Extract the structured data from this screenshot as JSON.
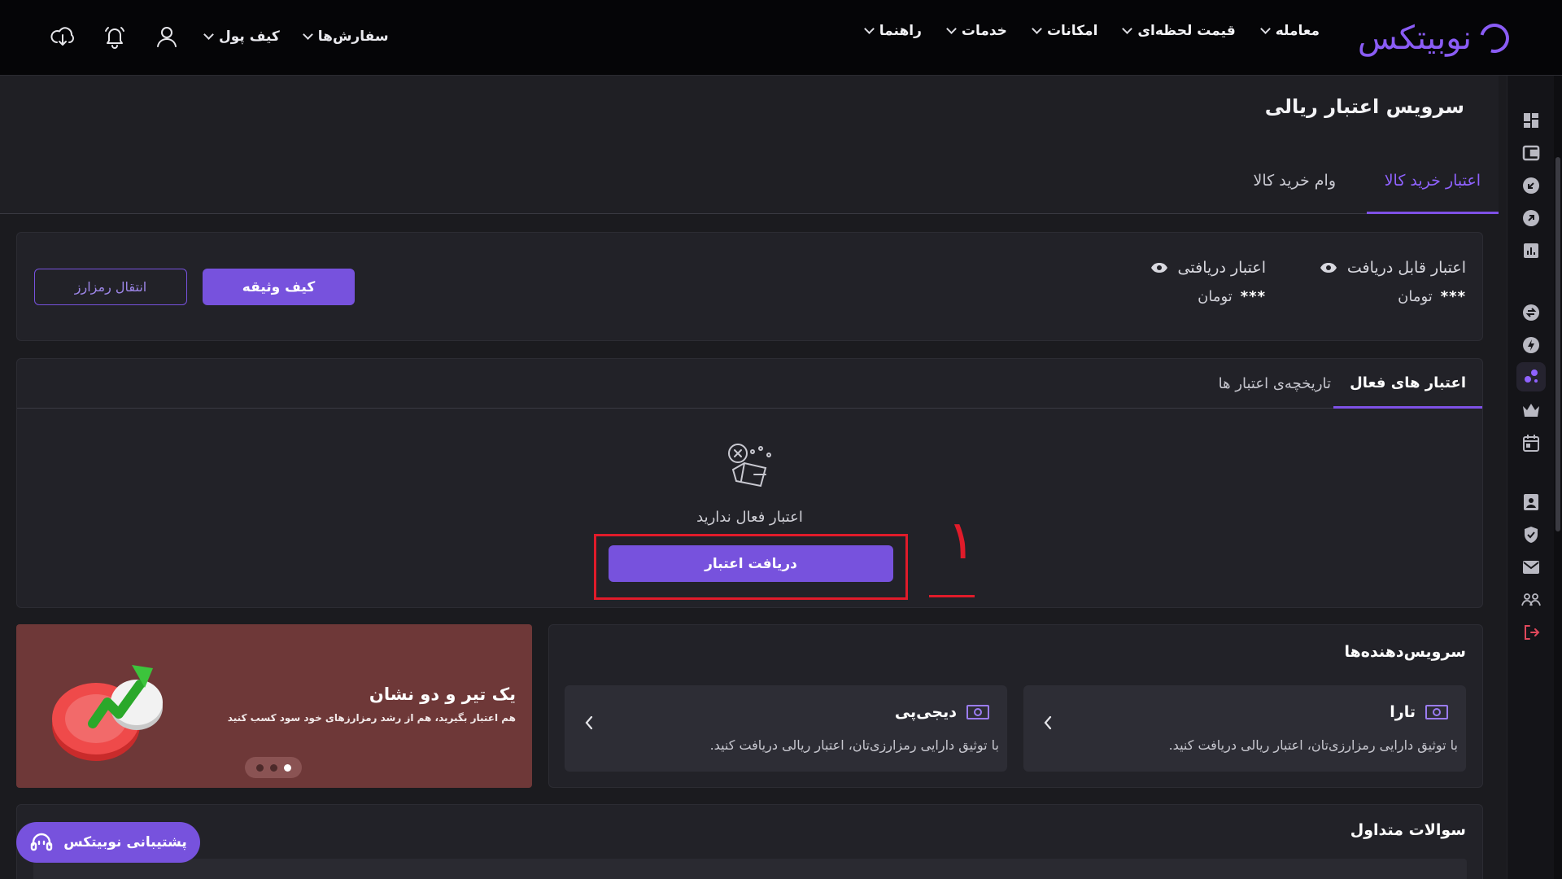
{
  "header": {
    "logo_text": "نوبیتکس",
    "nav": [
      {
        "label": "معامله"
      },
      {
        "label": "قیمت لحظه‌ای"
      },
      {
        "label": "امکانات"
      },
      {
        "label": "خدمات"
      },
      {
        "label": "راهنما"
      }
    ],
    "user_menus": {
      "orders": "سفارش‌ها",
      "wallet": "کیف پول"
    }
  },
  "page": {
    "title": "سرویس اعتبار ریالی",
    "tabs": [
      {
        "label": "اعتبار خرید کالا",
        "active": true
      },
      {
        "label": "وام خرید کالا",
        "active": false
      }
    ]
  },
  "credit_summary": {
    "receivable_label": "اعتبار قابل دریافت",
    "receivable_value": "***",
    "received_label": "اعتبار دریافتی",
    "received_value": "***",
    "currency": "تومان",
    "collateral_wallet_button": "کیف وثیقه",
    "crypto_transfer_button": "انتقال رمزارز"
  },
  "credits": {
    "tabs": [
      {
        "label": "اعتبار های فعال",
        "active": true
      },
      {
        "label": "تاریخچه‌ی اعتبار ها",
        "active": false
      }
    ],
    "empty_text": "اعتبار فعال ندارید",
    "get_credit_button": "دریافت اعتبار"
  },
  "annotation": {
    "number": "۱",
    "color": "#e01b2a"
  },
  "banner": {
    "title": "یک تیر و دو نشان",
    "subtitle": "هم اعتبار بگیرید، هم از رشد رمزارزهای خود سود کسب کنید",
    "slide_count": 3,
    "active_slide": 3
  },
  "providers": {
    "title": "سرویس‌دهنده‌ها",
    "items": [
      {
        "name": "تارا",
        "description": "با توثیق دارایی رمزارزی‌تان، اعتبار ریالی دریافت کنید."
      },
      {
        "name": "دیجی‌پی",
        "description": "با توثیق دارایی رمزارزی‌تان، اعتبار ریالی دریافت کنید."
      }
    ]
  },
  "faq": {
    "title": "سوالات متداول"
  },
  "support_button": "پشتیبانی نوبیتکس",
  "colors": {
    "accent": "#7752dd",
    "accent_text": "#8f62ff",
    "background": "#1b1b1f",
    "topbar": "#050507",
    "banner": "#6e3838"
  }
}
